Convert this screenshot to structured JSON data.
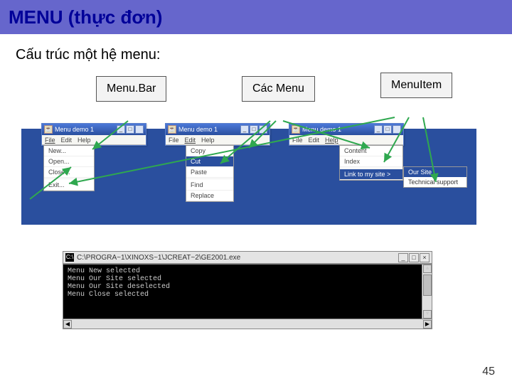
{
  "title": "MENU (thực đơn)",
  "subtitle": "Cấu trúc một hệ menu:",
  "labels": {
    "menubar": "Menu.Bar",
    "menus": "Các  Menu",
    "menuitem": "MenuItem"
  },
  "win1": {
    "title": "Menu demo 1",
    "menubar": [
      "File",
      "Edit",
      "Help"
    ],
    "dropdown": [
      "New...",
      "Open...",
      "Close...",
      "Exit..."
    ]
  },
  "win2": {
    "title": "Menu demo 1",
    "menubar": [
      "File",
      "Edit",
      "Help"
    ],
    "dropdown": [
      "Copy",
      "Cut",
      "Paste",
      "Find",
      "Replace"
    ],
    "highlight": "Cut"
  },
  "win3": {
    "title": "Menu demo 1",
    "menubar": [
      "File",
      "Edit",
      "Help"
    ],
    "dropdown": [
      "Content",
      "Index",
      "Link to my site >"
    ],
    "submenu": [
      "Our Site",
      "Technical support"
    ]
  },
  "console": {
    "title": "C:\\PROGRA~1\\XINOXS~1\\JCREAT~2\\GE2001.exe",
    "lines": [
      "Menu New selected",
      "Menu Our Site selected",
      "Menu Our Site deselected",
      "Menu Close selected"
    ]
  },
  "pageNumber": "45"
}
